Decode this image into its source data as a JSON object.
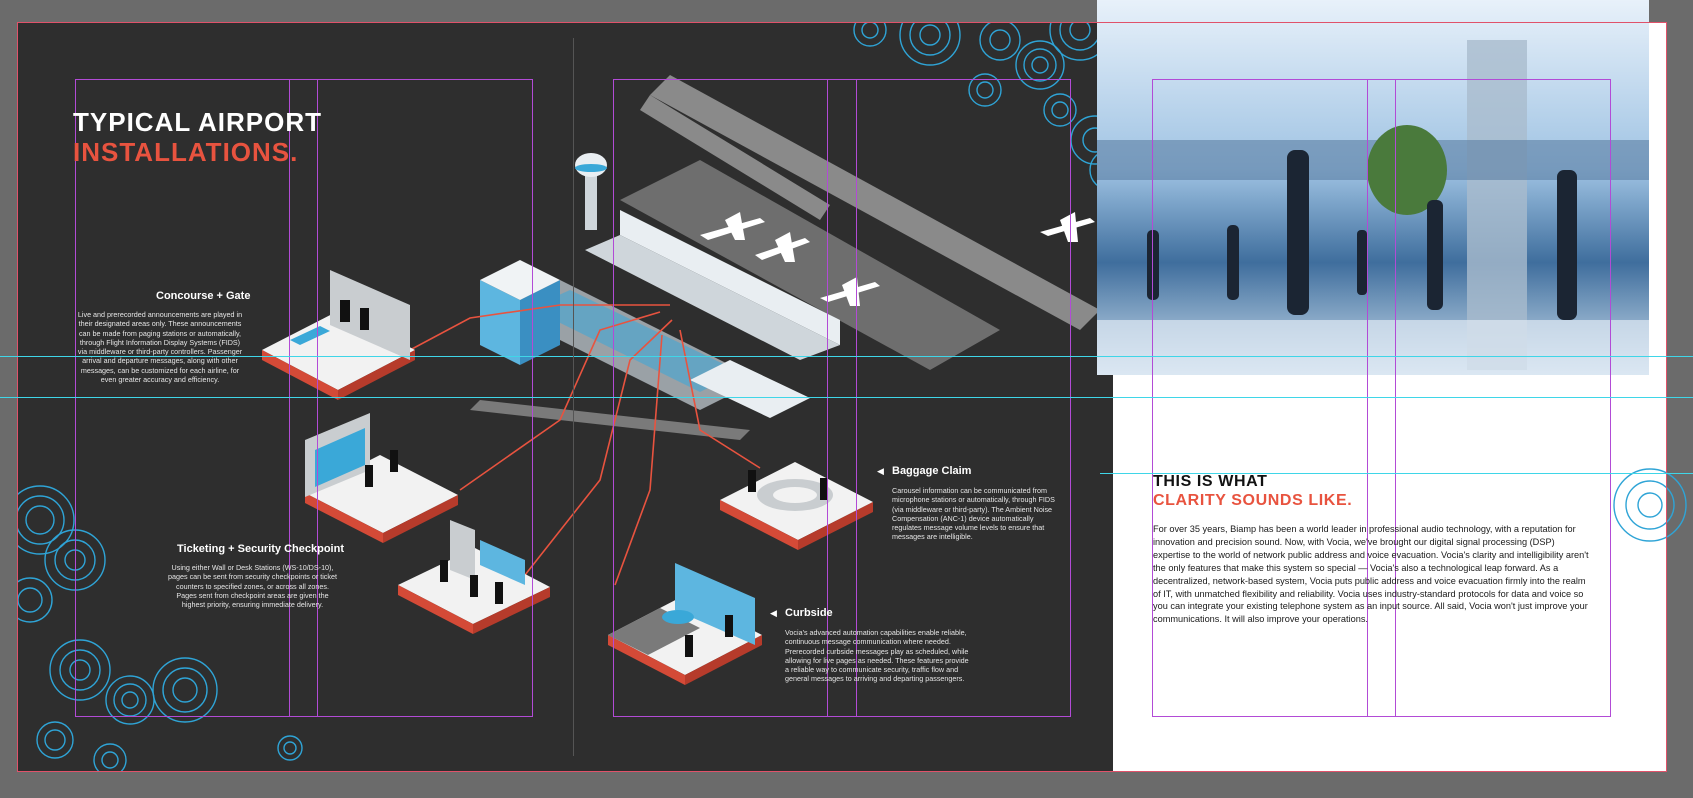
{
  "left_page": {
    "title_line1": "TYPICAL AIRPORT",
    "title_line2": "INSTALLATIONS.",
    "concourse": {
      "heading": "Concourse + Gate",
      "body": "Live and prerecorded announcements are played in their designated areas only. These announcements can be made from paging stations or automatically, through Flight Information Display Systems (FIDS) via middleware or third-party controllers. Passenger arrival and departure messages, along with other messages, can be customized for each airline, for even greater accuracy and efficiency."
    },
    "ticketing": {
      "heading": "Ticketing + Security Checkpoint",
      "body": "Using either Wall or Desk Stations (WS-10/DS-10), pages can be sent from security checkpoints or ticket counters to specified zones, or across all zones. Pages sent from checkpoint areas are given the highest priority, ensuring immediate delivery."
    },
    "baggage": {
      "heading": "Baggage Claim",
      "body": "Carousel information can be communicated from microphone stations or automatically, through FIDS (via middleware or third-party). The Ambient Noise Compensation (ANC-1) device automatically regulates message volume levels to ensure that messages are intelligible."
    },
    "curbside": {
      "heading": "Curbside",
      "body": "Vocia's advanced automation capabilities enable reliable, continuous message communication where needed. Prerecorded curbside messages play as scheduled, while allowing for live pages as needed. These features provide a reliable way to communicate security, traffic flow and general messages to arriving and departing passengers."
    }
  },
  "right_page": {
    "title_line1": "THIS IS WHAT",
    "title_line2": "CLARITY SOUNDS LIKE.",
    "body": "For over 35 years, Biamp has been a world leader in professional audio technology, with a reputation for innovation and precision sound. Now, with Vocia, we've brought our digital signal processing (DSP) expertise to the world of network public address and voice evacuation. Vocia's clarity and intelligibility aren't the only features that make this system so special — Vocia's also a technological leap forward. As a decentralized, network-based system, Vocia puts public address and voice evacuation firmly into the realm of IT, with unmatched flexibility and reliability. Vocia uses industry-standard protocols for data and voice so you can integrate your existing telephone system as an input source. All said, Vocia won't just improve your communications. It will also improve your operations."
  },
  "colors": {
    "accent": "#e8533f",
    "dark_page": "#2e2e2e",
    "blue": "#3aa8d8",
    "guide_margin": "#b24bd6",
    "guide_horizontal": "#3fd6e8",
    "bleed": "#e0526a"
  }
}
